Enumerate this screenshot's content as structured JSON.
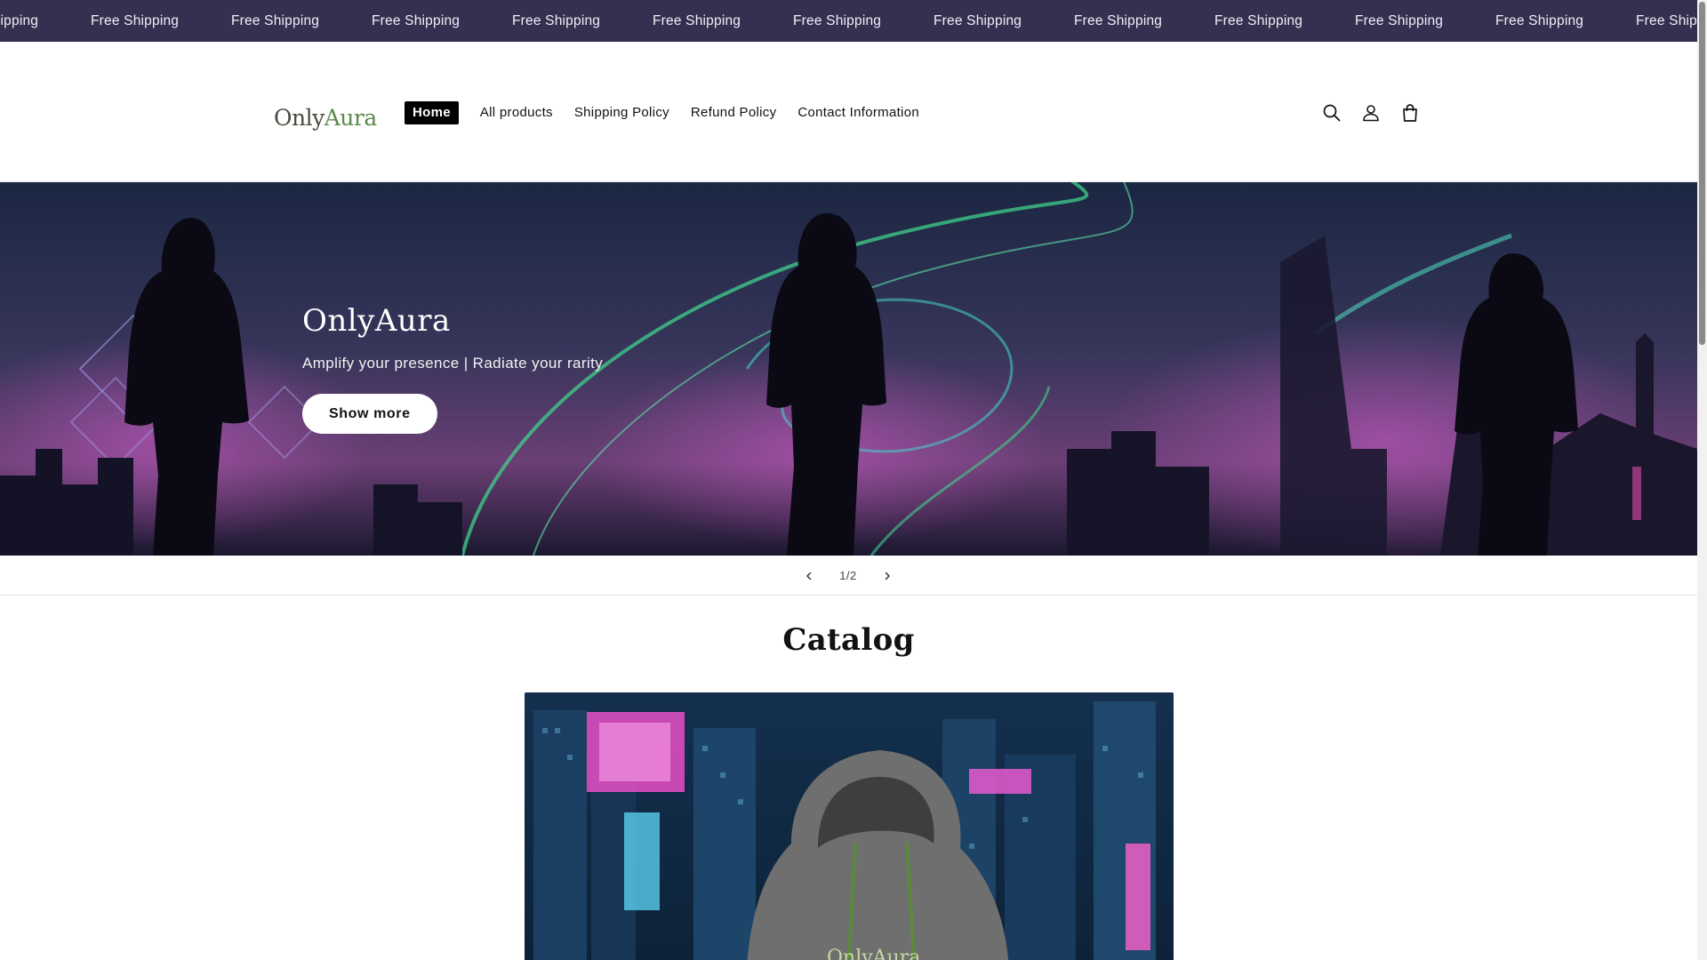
{
  "announcement": {
    "items": [
      "Free Shipping",
      "Free Shipping",
      "Free Shipping",
      "Free Shipping",
      "Free Shipping",
      "Free Shipping",
      "Free Shipping",
      "Free Shipping",
      "Free Shipping",
      "Free Shipping",
      "Free Shipping",
      "Free Shipping",
      "Free Shipping"
    ],
    "background": "#35304f"
  },
  "header": {
    "logo": {
      "part1": "Only",
      "part2": "Aura"
    },
    "nav": [
      {
        "label": "Home",
        "active": true
      },
      {
        "label": "All products"
      },
      {
        "label": "Shipping Policy"
      },
      {
        "label": "Refund Policy"
      },
      {
        "label": "Contact Information"
      }
    ],
    "icons": [
      "search-icon",
      "account-icon",
      "cart-icon"
    ]
  },
  "hero": {
    "title": "OnlyAura",
    "subtitle": "Amplify your presence | Radiate your rarity",
    "button": "Show more"
  },
  "slider": {
    "counter": "1/2",
    "icons": [
      "chevron-left-icon",
      "chevron-right-icon"
    ]
  },
  "catalog": {
    "title": "Catalog",
    "logo_text": "OnlyAura"
  },
  "colors": {
    "accent": "#000000",
    "announcement_bg": "#35304f",
    "hero_glow_green": "#3fd08a",
    "hero_glow_purple": "#9a4bd0"
  }
}
